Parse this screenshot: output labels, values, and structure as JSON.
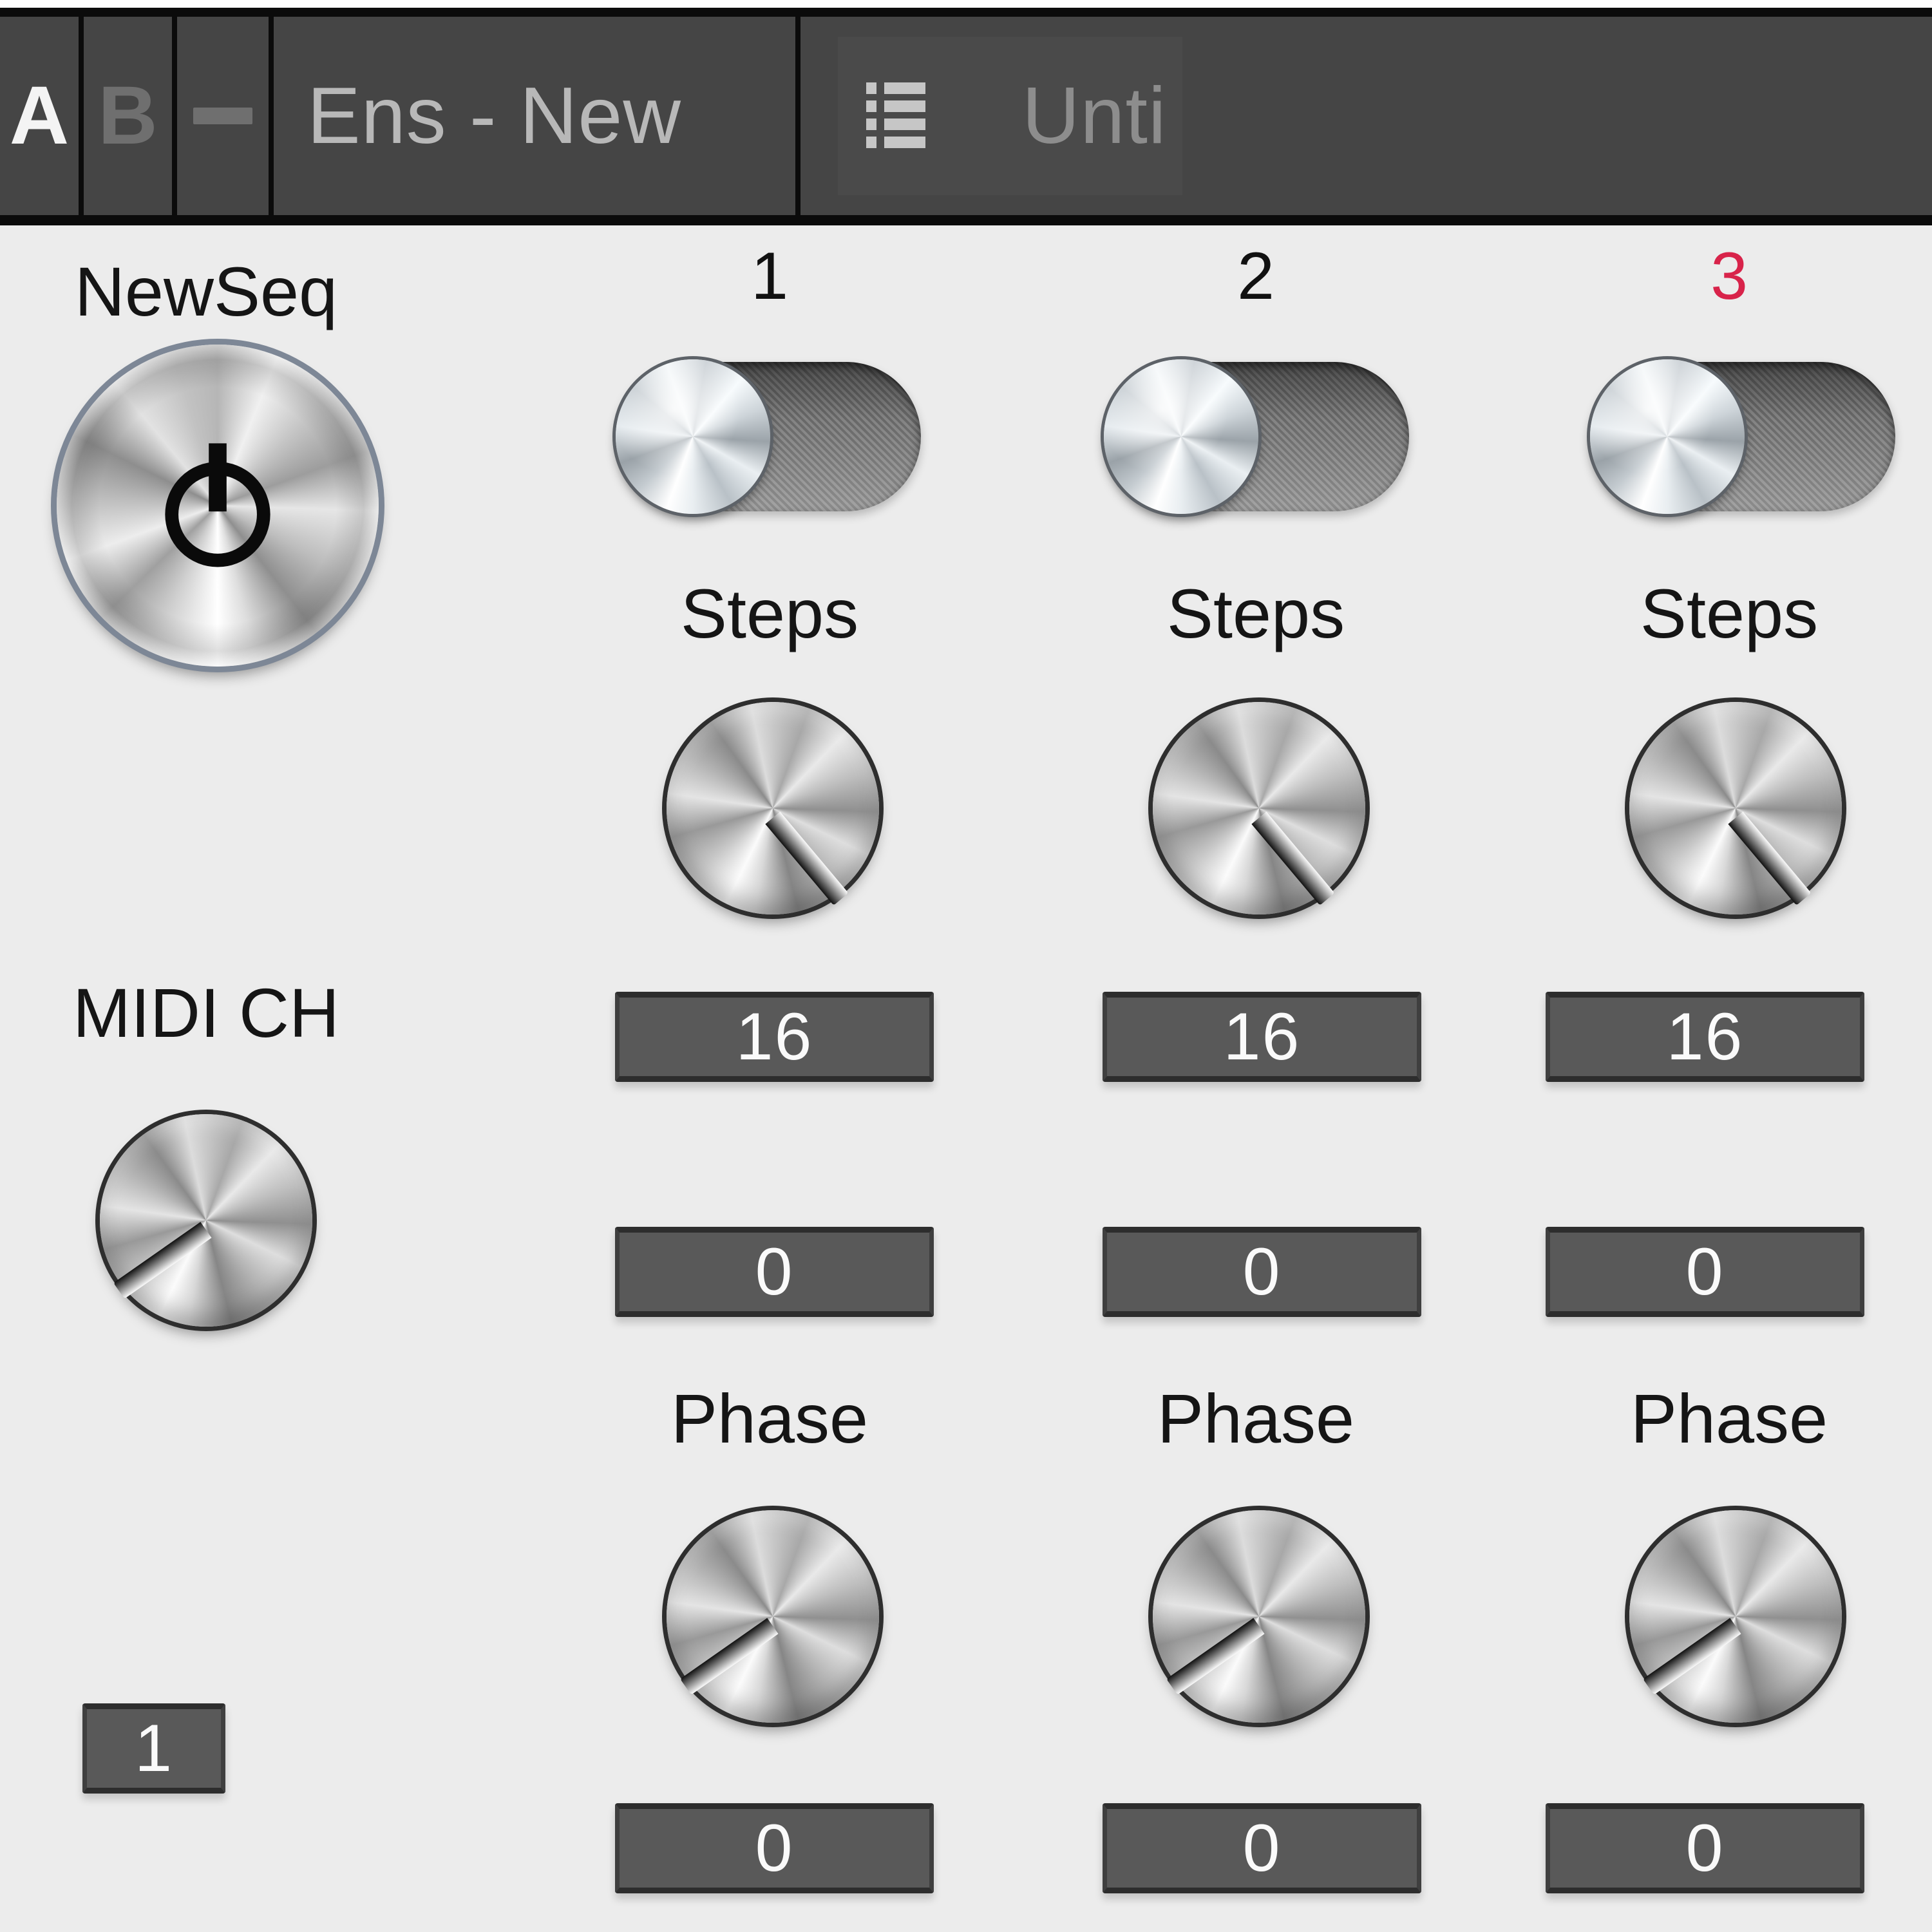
{
  "toolbar": {
    "snapshot_a": "A",
    "snapshot_b": "B",
    "minus_label": "–",
    "instrument_name": "Ens - New",
    "list_icon": "list-icon",
    "document_name": "Unti"
  },
  "transport": {
    "title": "NewSeq",
    "power_icon": "power-icon",
    "midi_ch_label": "MIDI CH",
    "midi_ch_value": "1"
  },
  "colors": {
    "panel_bg": "#ececec",
    "toolbar_bg": "#454545",
    "active_text": "#f4f4f4",
    "inactive_text": "#6f6f6f",
    "label_text": "#151515",
    "alert_red": "#d8234a",
    "display_bg": "#595959",
    "display_text": "#fafafa"
  },
  "voices": [
    {
      "index_label": "1",
      "index_highlighted": false,
      "enable_toggle_on": false,
      "steps_label": "Steps",
      "steps_value": "16",
      "steps_secondary_value": "0",
      "phase_label": "Phase",
      "phase_value": "0"
    },
    {
      "index_label": "2",
      "index_highlighted": false,
      "enable_toggle_on": false,
      "steps_label": "Steps",
      "steps_value": "16",
      "steps_secondary_value": "0",
      "phase_label": "Phase",
      "phase_value": "0"
    },
    {
      "index_label": "3",
      "index_highlighted": true,
      "enable_toggle_on": false,
      "steps_label": "Steps",
      "steps_value": "16",
      "steps_secondary_value": "0",
      "phase_label": "Phase",
      "phase_value": "0"
    }
  ]
}
